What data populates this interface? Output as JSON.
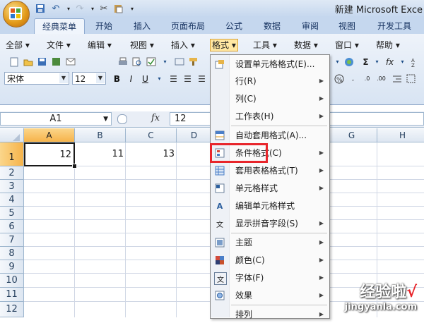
{
  "app": {
    "title": "新建 Microsoft Exce"
  },
  "ribbon_tabs": [
    "经典菜单",
    "开始",
    "插入",
    "页面布局",
    "公式",
    "数据",
    "审阅",
    "视图",
    "开发工具"
  ],
  "menubar": [
    "全部",
    "文件",
    "编辑",
    "视图",
    "插入",
    "格式",
    "工具",
    "数据",
    "窗口",
    "帮助"
  ],
  "font": {
    "name": "宋体",
    "size": "12"
  },
  "formula_bar": {
    "name_box": "A1",
    "fx": "fx",
    "value": "12"
  },
  "columns": [
    "A",
    "B",
    "C",
    "D",
    "G",
    "H"
  ],
  "rows": [
    "1",
    "2",
    "3",
    "4",
    "5",
    "6",
    "7",
    "8",
    "9",
    "10",
    "11",
    "12"
  ],
  "cells": {
    "A1": "12",
    "B1": "11",
    "C1": "13"
  },
  "format_menu": [
    {
      "label": "设置单元格格式(E)...",
      "icon": "format-cells-icon",
      "submenu": false
    },
    {
      "label": "行(R)",
      "icon": "",
      "submenu": true
    },
    {
      "label": "列(C)",
      "icon": "",
      "submenu": true
    },
    {
      "label": "工作表(H)",
      "icon": "",
      "submenu": true
    },
    {
      "label": "自动套用格式(A)...",
      "icon": "autoformat-icon",
      "submenu": false
    },
    {
      "label": "条件格式(C)",
      "icon": "conditional-format-icon",
      "submenu": true
    },
    {
      "label": "套用表格格式(T)",
      "icon": "table-format-icon",
      "submenu": true
    },
    {
      "label": "单元格样式",
      "icon": "cell-styles-icon",
      "submenu": true
    },
    {
      "label": "编辑单元格样式",
      "icon": "edit-styles-icon",
      "submenu": false
    },
    {
      "label": "显示拼音字段(S)",
      "icon": "phonetic-icon",
      "submenu": true
    },
    {
      "label": "主题",
      "icon": "theme-icon",
      "submenu": true
    },
    {
      "label": "颜色(C)",
      "icon": "colors-icon",
      "submenu": true
    },
    {
      "label": "字体(F)",
      "icon": "fonts-icon",
      "submenu": true
    },
    {
      "label": "效果",
      "icon": "effects-icon",
      "submenu": true
    },
    {
      "label": "排列",
      "icon": "",
      "submenu": true
    }
  ],
  "watermark": {
    "brand": "经验啦",
    "check": "√",
    "url": "jingyanla.com"
  },
  "colors": {
    "highlight": "#e8252b",
    "selected_header": "#f6b34a",
    "ribbon": "#d8e4f3"
  }
}
